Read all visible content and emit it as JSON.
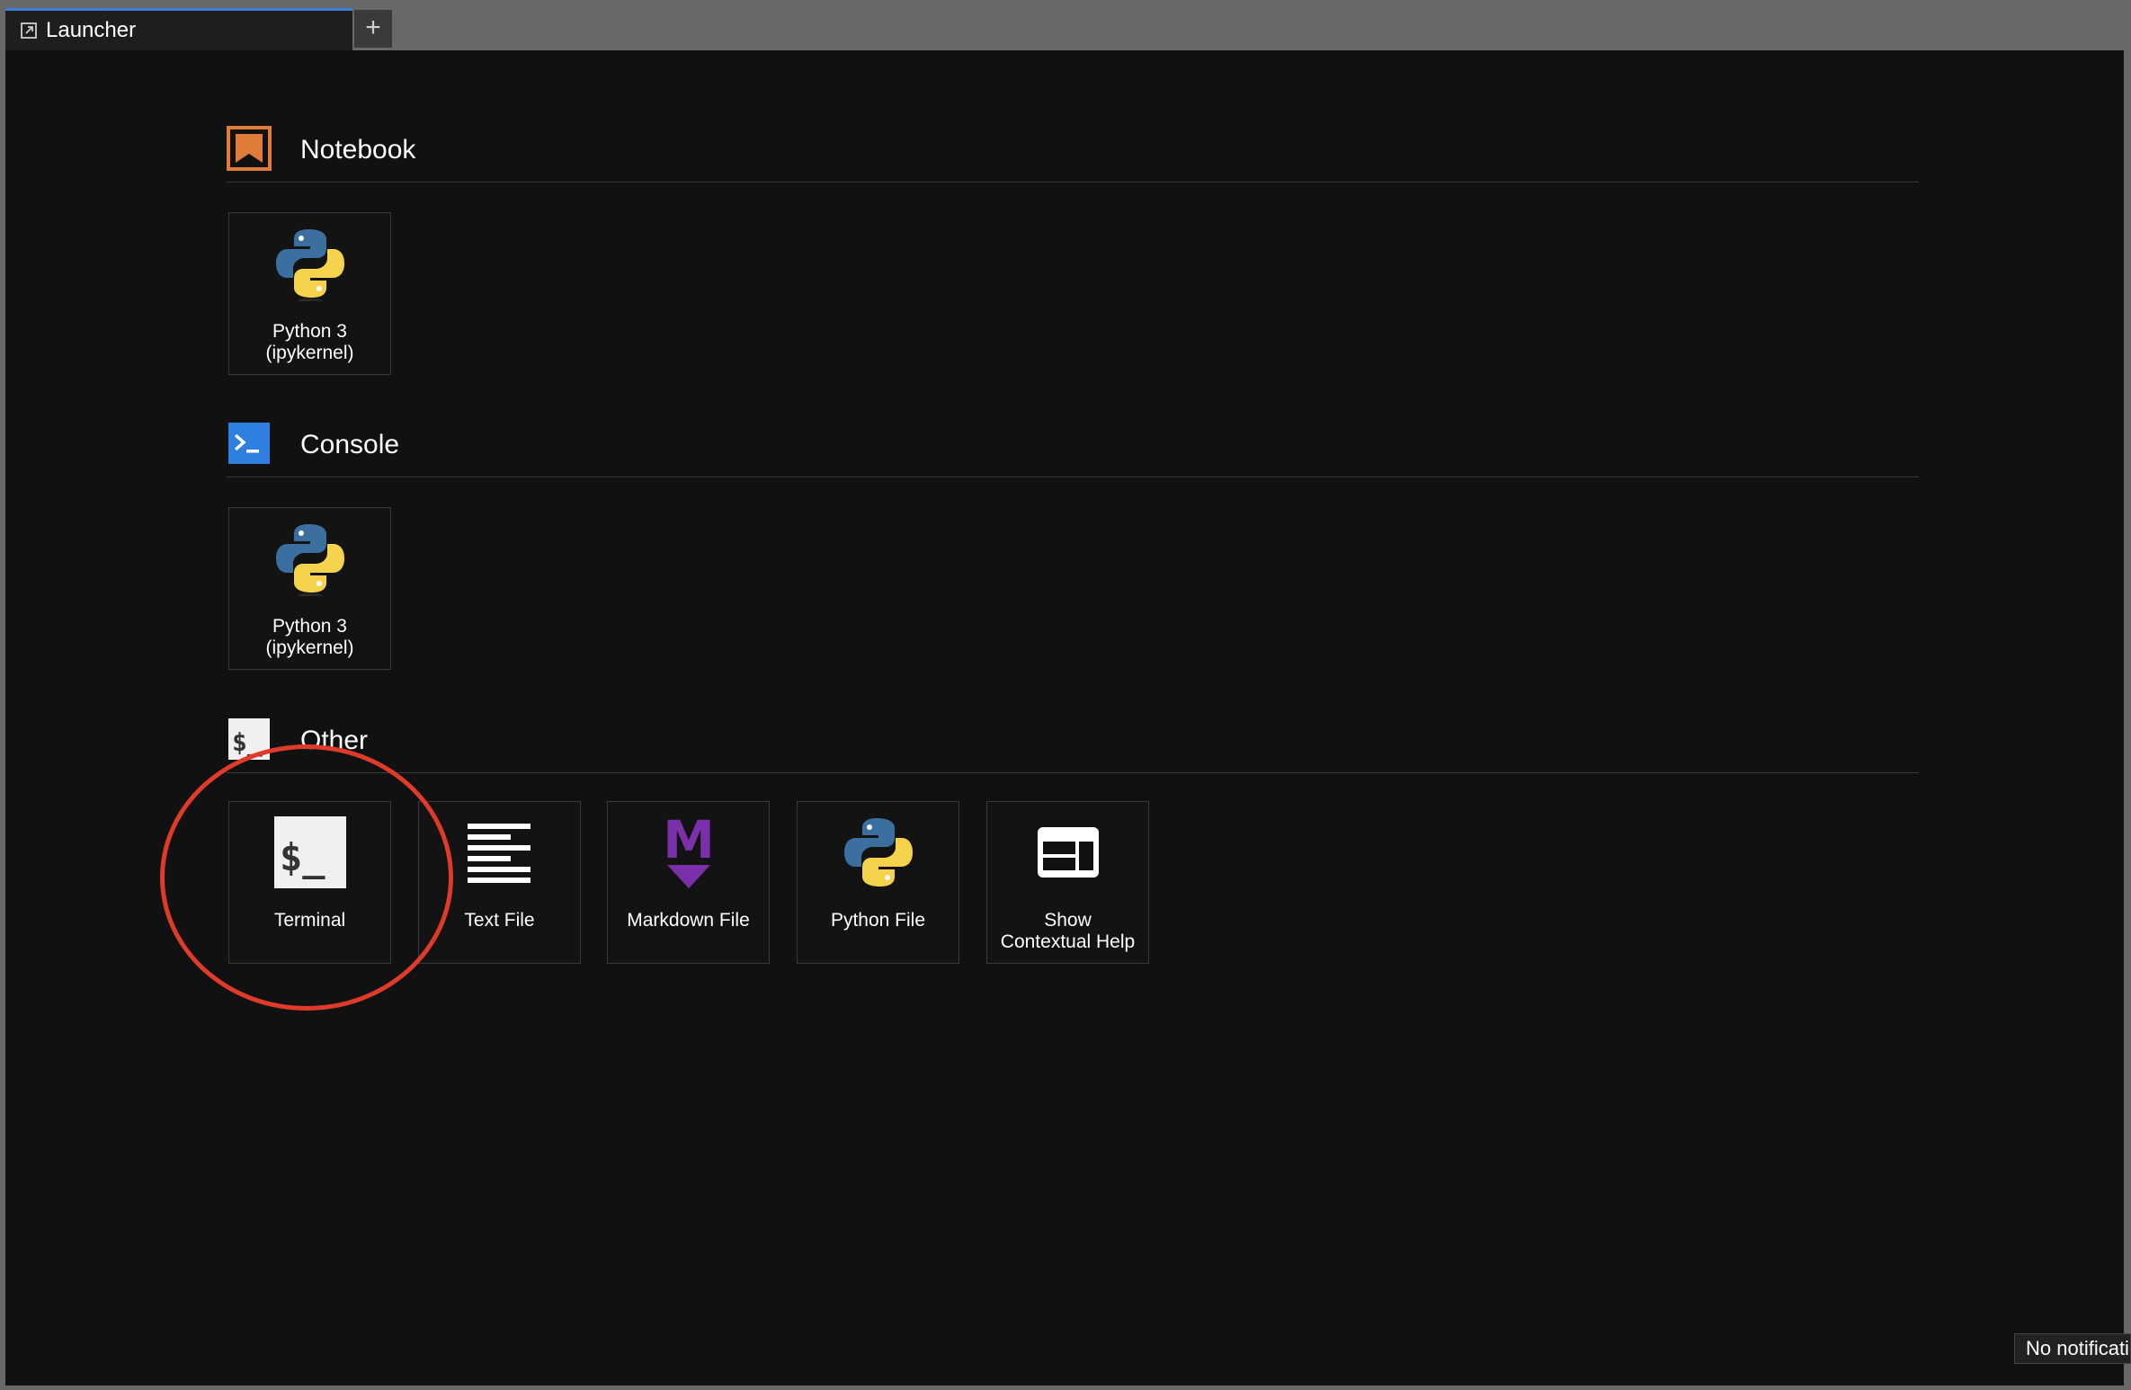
{
  "tab": {
    "label": "Launcher",
    "icon": "launcher-icon"
  },
  "add_tab": {
    "label": "+"
  },
  "sections": {
    "notebook": {
      "title": "Notebook",
      "icon": "notebook-icon",
      "items": [
        {
          "label": "Python 3\n(ipykernel)",
          "icon": "python-icon"
        }
      ]
    },
    "console": {
      "title": "Console",
      "icon": "console-icon",
      "items": [
        {
          "label": "Python 3\n(ipykernel)",
          "icon": "python-icon"
        }
      ]
    },
    "other": {
      "title": "Other",
      "icon": "terminal-icon",
      "items": [
        {
          "label": "Terminal",
          "icon": "terminal-icon"
        },
        {
          "label": "Text File",
          "icon": "text-file-icon"
        },
        {
          "label": "Markdown File",
          "icon": "markdown-icon"
        },
        {
          "label": "Python File",
          "icon": "python-icon"
        },
        {
          "label": "Show\nContextual Help",
          "icon": "contextual-help-icon"
        }
      ]
    }
  },
  "notification": {
    "label": "No notifications"
  },
  "colors": {
    "accent": "#3b7fd9",
    "notebook_orange": "#e07b39",
    "console_blue": "#2f7fe0",
    "markdown_purple": "#7b2fa8",
    "annotation_red": "#e03a2a",
    "python_blue": "#3a6f9f",
    "python_yellow": "#f5d24b"
  }
}
